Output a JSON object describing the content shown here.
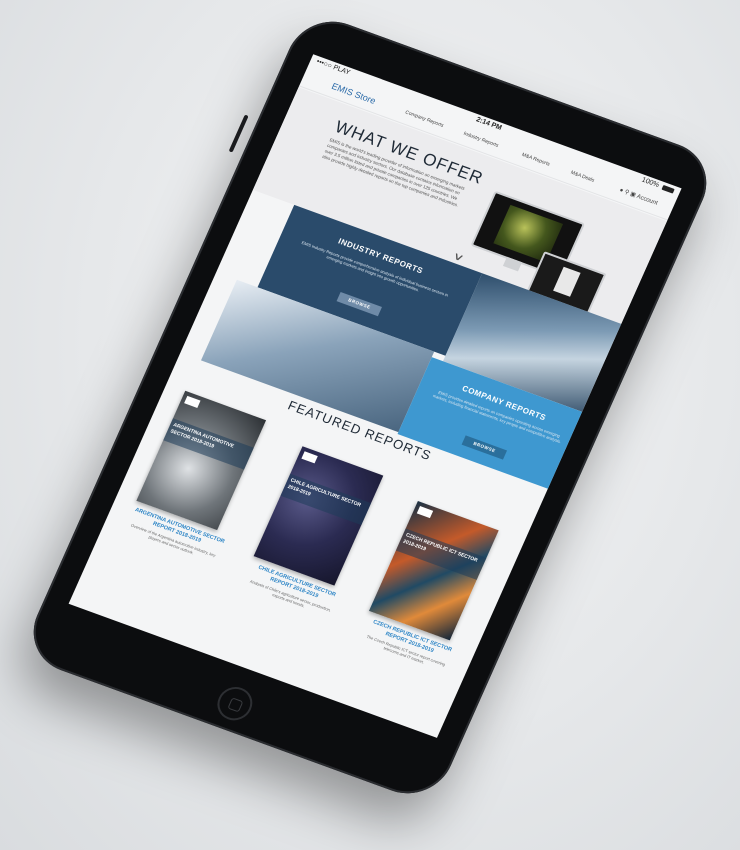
{
  "status_bar": {
    "carrier": "•••○○ PLAY",
    "time": "2:14 PM",
    "battery": "100%"
  },
  "nav": {
    "logo": "EMIS Store",
    "items": [
      "Company Reports",
      "Industry Reports",
      "M&A Reports",
      "M&A Deals"
    ],
    "account_label": "Account"
  },
  "hero": {
    "title": "WHAT WE OFFER",
    "text": "EMIS is the world's leading provider of information on emerging markets companies and industry sectors. Our database contains information on over 3.5 million listed and private companies in over 125 countries. We also provide highly detailed reports on the top companies and industries."
  },
  "industry_reports": {
    "title": "INDUSTRY REPORTS",
    "text": "EMIS Industry Reports provide comprehensive analysis of individual business sectors in emerging markets and insight into growth opportunities.",
    "button": "BROWSE"
  },
  "company_reports": {
    "title": "COMPANY REPORTS",
    "text": "EMIS provides detailed reports on companies operating across emerging markets, including financial statements, key people and competitive analysis.",
    "button": "BROWSE"
  },
  "featured": {
    "title": "FEATURED REPORTS",
    "reports": [
      {
        "cover": "ARGENTINA AUTOMOTIVE SECTOR 2018-2019",
        "title": "ARGENTINA AUTOMOTIVE SECTOR REPORT 2018-2019",
        "desc": "Overview of the Argentina automotive industry, key players and sector outlook."
      },
      {
        "cover": "CHILE AGRICULTURE SECTOR 2018-2019",
        "title": "CHILE AGRICULTURE SECTOR REPORT 2018-2019",
        "desc": "Analysis of Chile's agriculture sector, production, exports and trends."
      },
      {
        "cover": "CZECH REPUBLIC ICT SECTOR 2018-2019",
        "title": "CZECH REPUBLIC ICT SECTOR REPORT 2018-2019",
        "desc": "The Czech Republic ICT sector report covering telecoms and IT market."
      }
    ]
  }
}
